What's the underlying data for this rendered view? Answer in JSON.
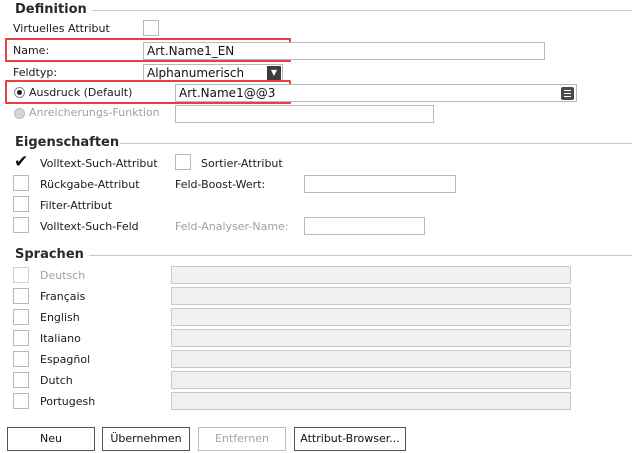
{
  "definition": {
    "title": "Definition",
    "virtual_label": "Virtuelles Attribut",
    "name_label": "Name:",
    "name_value": "Art.Name1_EN",
    "feldtyp_label": "Feldtyp:",
    "feldtyp_value": "Alphanumerisch",
    "ausdruck_label": "Ausdruck (Default)",
    "ausdruck_value": "Art.Name1@@3",
    "anreicherung_label": "Anreicherungs-Funktion",
    "anreicherung_value": ""
  },
  "eigenschaften": {
    "title": "Eigenschaften",
    "volltext_such_attribut": {
      "label": "Volltext-Such-Attribut",
      "checked": true
    },
    "sortier_attribut": {
      "label": "Sortier-Attribut",
      "checked": false
    },
    "rueckgabe_attribut": {
      "label": "Rückgabe-Attribut",
      "checked": false
    },
    "feld_boost_label": "Feld-Boost-Wert:",
    "feld_boost_value": "",
    "filter_attribut": {
      "label": "Filter-Attribut",
      "checked": false
    },
    "volltext_such_feld": {
      "label": "Volltext-Such-Feld",
      "checked": false
    },
    "feld_analyser_label": "Feld-Analyser-Name:",
    "feld_analyser_value": ""
  },
  "sprachen": {
    "title": "Sprachen",
    "items": [
      {
        "label": "Deutsch",
        "value": "",
        "disabled": true
      },
      {
        "label": "Français",
        "value": ""
      },
      {
        "label": "English",
        "value": ""
      },
      {
        "label": "Italiano",
        "value": ""
      },
      {
        "label": "Espagñol",
        "value": ""
      },
      {
        "label": "Dutch",
        "value": ""
      },
      {
        "label": "Portugesh",
        "value": ""
      }
    ]
  },
  "buttons": {
    "neu": "Neu",
    "uebernehmen": "Übernehmen",
    "entfernen": "Entfernen",
    "attribut_browser": "Attribut-Browser..."
  },
  "colors": {
    "highlight": "#e8403f",
    "section_line": "#c8c8c8",
    "disabled_text": "#a0a0a0"
  }
}
